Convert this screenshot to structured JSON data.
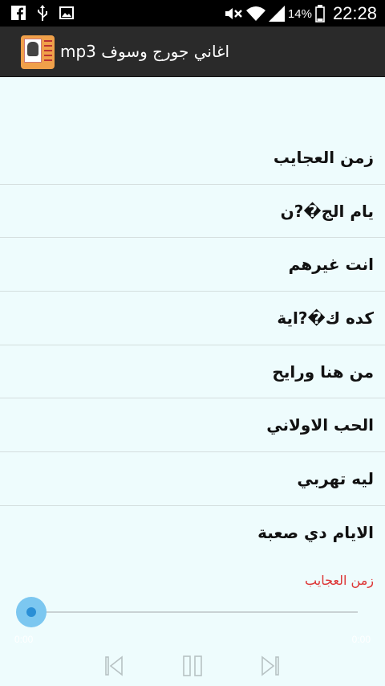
{
  "status_bar": {
    "left_icons": [
      "facebook-icon",
      "usb-icon",
      "image-icon"
    ],
    "right_icons": [
      "mute-icon",
      "wifi-icon",
      "signal-icon",
      "battery-icon"
    ],
    "battery_percent": "14%",
    "time": "22:28"
  },
  "app_bar": {
    "title": "اغاني جورج وسوف mp3"
  },
  "songs": [
    "زمن العجايب",
    "يام الج�?ن",
    "انت غيرهم",
    "كده ك�?اية",
    "من هنا ورايح",
    "الحب الاولاني",
    "ليه تهربي",
    "الايام دي صعبة"
  ],
  "player": {
    "now_playing": "زمن العجايب",
    "time_elapsed": "0:00",
    "time_total": "0:00",
    "progress": 0
  }
}
